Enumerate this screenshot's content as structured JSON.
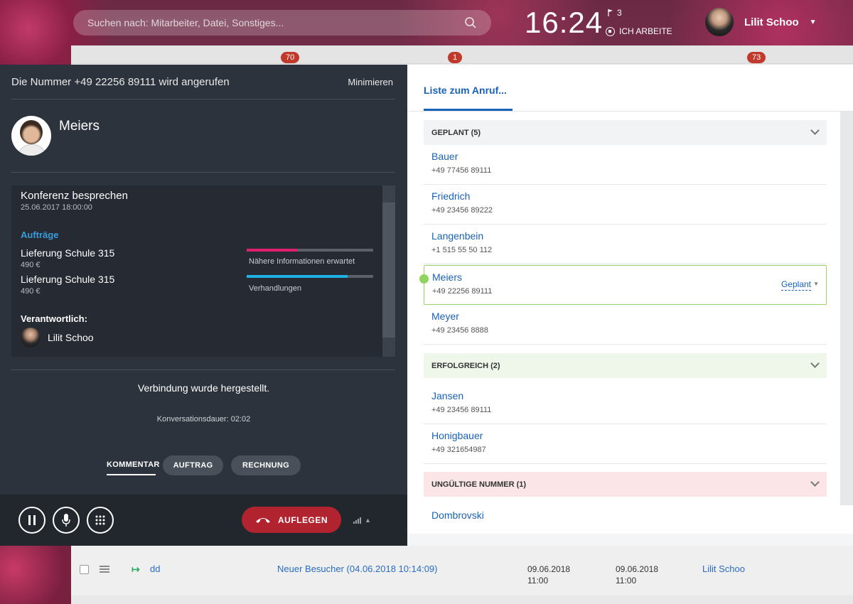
{
  "search": {
    "placeholder": "Suchen nach: Mitarbeiter, Datei, Sonstiges..."
  },
  "header": {
    "clock": "16:24",
    "flag_count": "3",
    "status": "ICH ARBEITE",
    "user_name": "Lilit Schoo"
  },
  "background": {
    "badges": [
      "70",
      "1",
      "73"
    ],
    "row": {
      "name": "dd",
      "visitor": "Neuer Besucher (04.06.2018 10:14:09)",
      "date1": "09.06.2018",
      "time1": "11:00",
      "date2": "09.06.2018",
      "time2": "11:00",
      "owner": "Lilit Schoo"
    }
  },
  "call": {
    "title": "Die Nummer +49 22256 89111 wird angerufen",
    "minimize": "Minimieren",
    "contact_name": "Meiers",
    "event_title": "Konferenz besprechen",
    "event_date": "25.06.2017 18:00:00",
    "orders_label": "Aufträge",
    "orders": [
      {
        "name": "Lieferung Schule 315",
        "price": "490 €",
        "status": "Nähere Informationen erwartet",
        "progress": 0.4,
        "color": "#e0206e"
      },
      {
        "name": "Lieferung Schule 315",
        "price": "490 €",
        "status": "Verhandlungen",
        "progress": 0.8,
        "color": "#1fb0e6"
      }
    ],
    "responsible_label": "Verantwortlich:",
    "responsible_name": "Lilit Schoo",
    "connection": "Verbindung wurde hergestellt.",
    "duration": "Konversationsdauer: 02:02",
    "tabs": {
      "comment": "KOMMENTAR",
      "order": "AUFTRAG",
      "invoice": "RECHNUNG"
    },
    "hangup": "AUFLEGEN"
  },
  "list": {
    "tab": "Liste zum Anruf...",
    "groups": [
      {
        "label": "GEPLANT (5)",
        "color": "#f1f3f4"
      },
      {
        "label": "ERFOLGREICH (2)",
        "color": "#eef7ea"
      },
      {
        "label": "UNGÜLTIGE NUMMER (1)",
        "color": "#fbe5e6"
      }
    ],
    "entries": [
      {
        "name": "Bauer",
        "phone": "+49 77456 89111"
      },
      {
        "name": "Friedrich",
        "phone": "+49 23456 89222"
      },
      {
        "name": "Langenbein",
        "phone": "+1 515 55 50 112"
      },
      {
        "name": "Meiers",
        "phone": "+49 22256 89111",
        "status": "Geplant"
      },
      {
        "name": "Meyer",
        "phone": "+49 23456 8888"
      },
      {
        "name": "Jansen",
        "phone": "+49 23456 89111"
      },
      {
        "name": "Honigbauer",
        "phone": "+49 321654987"
      },
      {
        "name": "Dombrovski",
        "phone": ""
      }
    ]
  }
}
